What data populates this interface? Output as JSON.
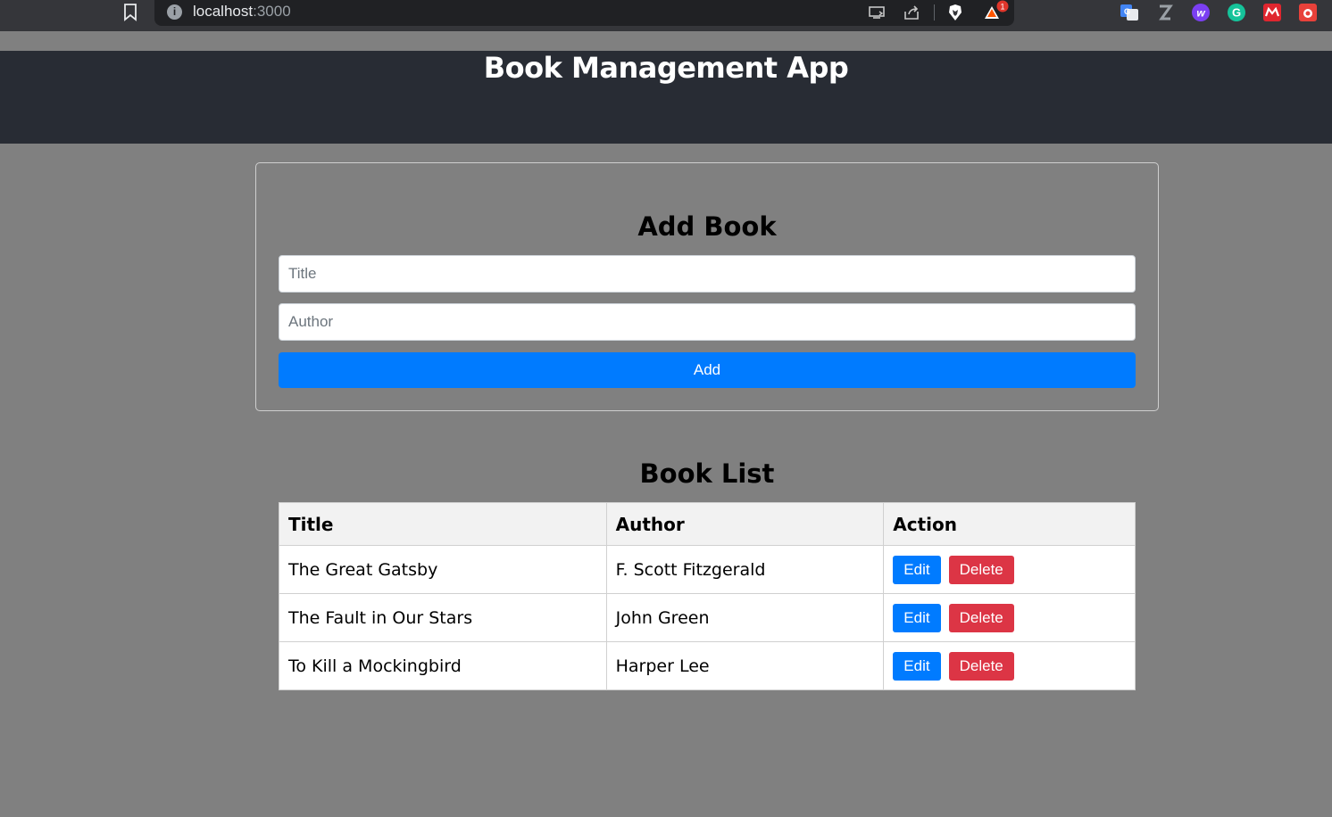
{
  "browser": {
    "url_host": "localhost",
    "url_port": ":3000",
    "extension_badge": "1",
    "colors": {
      "chrome": "#35363a",
      "urlbar": "#202124"
    }
  },
  "header": {
    "title": "Book Management App",
    "background": "#282c34"
  },
  "form": {
    "heading": "Add Book",
    "title_placeholder": "Title",
    "author_placeholder": "Author",
    "add_label": "Add"
  },
  "list": {
    "heading": "Book List",
    "columns": [
      "Title",
      "Author",
      "Action"
    ],
    "rows": [
      {
        "title": "The Great Gatsby",
        "author": "F. Scott Fitzgerald",
        "edit": "Edit",
        "delete": "Delete"
      },
      {
        "title": "The Fault in Our Stars",
        "author": "John Green",
        "edit": "Edit",
        "delete": "Delete"
      },
      {
        "title": "To Kill a Mockingbird",
        "author": "Harper Lee",
        "edit": "Edit",
        "delete": "Delete"
      }
    ]
  },
  "colors": {
    "primary": "#007bff",
    "danger": "#dc3545",
    "page_bg": "#808080"
  }
}
